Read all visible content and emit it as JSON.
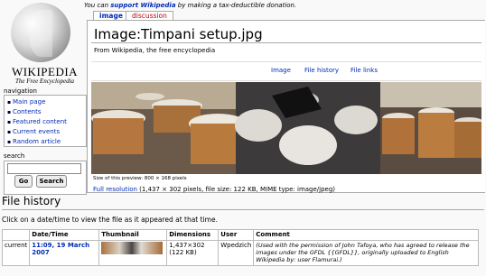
{
  "logo": {
    "wordmark": "WIKIPEDIA",
    "tagline": "The Free Encyclopedia"
  },
  "sitenotice": {
    "prefix": "You can ",
    "link": "support Wikipedia",
    "suffix": " by making a tax-deductible donation."
  },
  "tabs": [
    {
      "label": "image"
    },
    {
      "label": "discussion"
    }
  ],
  "page": {
    "title": "Image:Timpani setup.jpg",
    "subtitle": "From Wikipedia, the free encyclopedia"
  },
  "filetoc": [
    {
      "label": "Image"
    },
    {
      "label": "File history"
    },
    {
      "label": "File links"
    }
  ],
  "preview": {
    "note": "Size of this preview: 800 × 168 pixels",
    "fullres_link": "Full resolution",
    "fullres_info": " (1,437 × 302 pixels, file size: 122 KB, MIME type: image/jpeg)"
  },
  "sidebar": {
    "navigation_heading": "navigation",
    "nav_items": [
      {
        "label": "Main page"
      },
      {
        "label": "Contents"
      },
      {
        "label": "Featured content"
      },
      {
        "label": "Current events"
      },
      {
        "label": "Random article"
      }
    ],
    "search_heading": "search",
    "search_value": "",
    "go_label": "Go",
    "search_label": "Search"
  },
  "file_history": {
    "title": "File history",
    "intro": "Click on a date/time to view the file as it appeared at that time.",
    "columns": [
      "",
      "Date/Time",
      "Thumbnail",
      "Dimensions",
      "User",
      "Comment"
    ],
    "rows": [
      {
        "status": "current",
        "datetime": "11:09, 19 March 2007",
        "dimensions_line1": "1,437×302",
        "dimensions_line2": "(122 KB)",
        "user": "Wpedzich",
        "comment": "(Used with the permission of John Tafoya, who has agreed to release the images under the GFDL {{GFDL}}, originally uploaded to English Wikipedia by: user Flamurai.)"
      }
    ]
  },
  "colors": {
    "link": "#002bb8",
    "new_link": "#ba0000",
    "border": "#aaaaaa",
    "background": "#f9f9f9"
  }
}
